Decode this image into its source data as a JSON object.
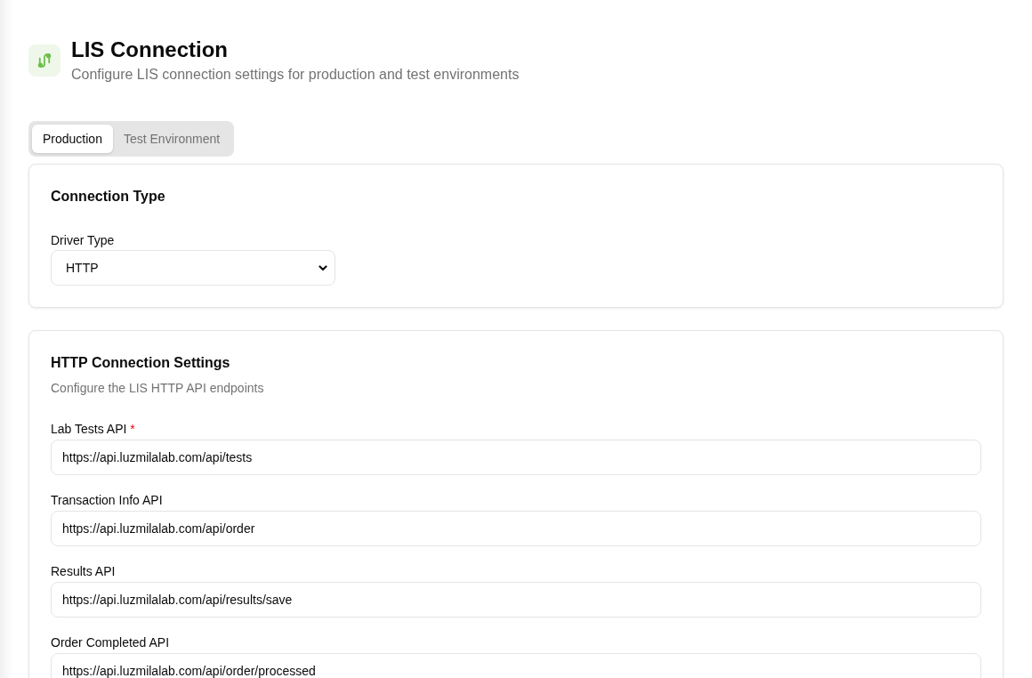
{
  "header": {
    "title": "LIS Connection",
    "subtitle": "Configure LIS connection settings for production and test environments"
  },
  "tabs": [
    {
      "label": "Production",
      "selected": true
    },
    {
      "label": "Test Environment",
      "selected": false
    }
  ],
  "connection_type": {
    "title": "Connection Type",
    "driver_type": {
      "label": "Driver Type",
      "value": "HTTP"
    }
  },
  "http_settings": {
    "title": "HTTP Connection Settings",
    "description": "Configure the LIS HTTP API endpoints",
    "fields": [
      {
        "label": "Lab Tests API",
        "required_mark": "*",
        "value": "https://api.luzmilalab.com/api/tests"
      },
      {
        "label": "Transaction Info API",
        "value": "https://api.luzmilalab.com/api/order"
      },
      {
        "label": "Results API",
        "value": "https://api.luzmilalab.com/api/results/save"
      },
      {
        "label": "Order Completed API",
        "value": "https://api.luzmilalab.com/api/order/processed"
      }
    ]
  }
}
